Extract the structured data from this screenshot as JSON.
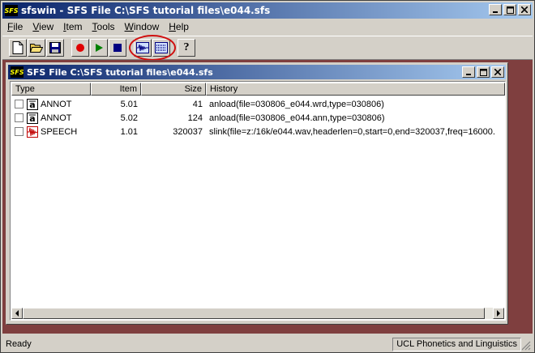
{
  "window": {
    "app_icon_text": "SFS",
    "title": "sfswin - SFS File C:\\SFS tutorial files\\e044.sfs"
  },
  "menu": {
    "items": [
      {
        "label": "File",
        "accel": "F",
        "rest": "ile"
      },
      {
        "label": "View",
        "accel": "V",
        "rest": "iew"
      },
      {
        "label": "Item",
        "accel": "I",
        "rest": "tem"
      },
      {
        "label": "Tools",
        "accel": "T",
        "rest": "ools"
      },
      {
        "label": "Window",
        "accel": "W",
        "rest": "indow"
      },
      {
        "label": "Help",
        "accel": "H",
        "rest": "elp"
      }
    ]
  },
  "toolbar": {
    "buttons": [
      {
        "name": "new-file-icon"
      },
      {
        "name": "open-folder-icon"
      },
      {
        "name": "save-disk-icon"
      },
      {
        "name": "record-icon",
        "color": "#e00000"
      },
      {
        "name": "play-icon",
        "color": "#008000"
      },
      {
        "name": "stop-icon",
        "color": "#000080"
      },
      {
        "name": "waveform-display-icon"
      },
      {
        "name": "spectrogram-display-icon"
      },
      {
        "name": "help-icon",
        "glyph": "?"
      }
    ],
    "highlight_color": "#d01010"
  },
  "child": {
    "title": "SFS File C:\\SFS tutorial files\\e044.sfs",
    "columns": {
      "type": "Type",
      "item": "Item",
      "size": "Size",
      "history": "History"
    },
    "rows": [
      {
        "type": "ANNOT",
        "icon": "annotation-icon",
        "item": "5.01",
        "size": "41",
        "history": "anload(file=030806_e044.wrd,type=030806)"
      },
      {
        "type": "ANNOT",
        "icon": "annotation-icon",
        "item": "5.02",
        "size": "124",
        "history": "anload(file=030806_e044.ann,type=030806)"
      },
      {
        "type": "SPEECH",
        "icon": "speech-waveform-icon",
        "item": "1.01",
        "size": "320037",
        "history": "slink(file=z:/16k/e044.wav,headerlen=0,start=0,end=320037,freq=16000."
      }
    ]
  },
  "status": {
    "left": "Ready",
    "right": "UCL Phonetics and Linguistics"
  },
  "colors": {
    "titlebar_start": "#0a246a",
    "titlebar_end": "#a6caf0",
    "mdi_background": "#7f3f3f"
  }
}
